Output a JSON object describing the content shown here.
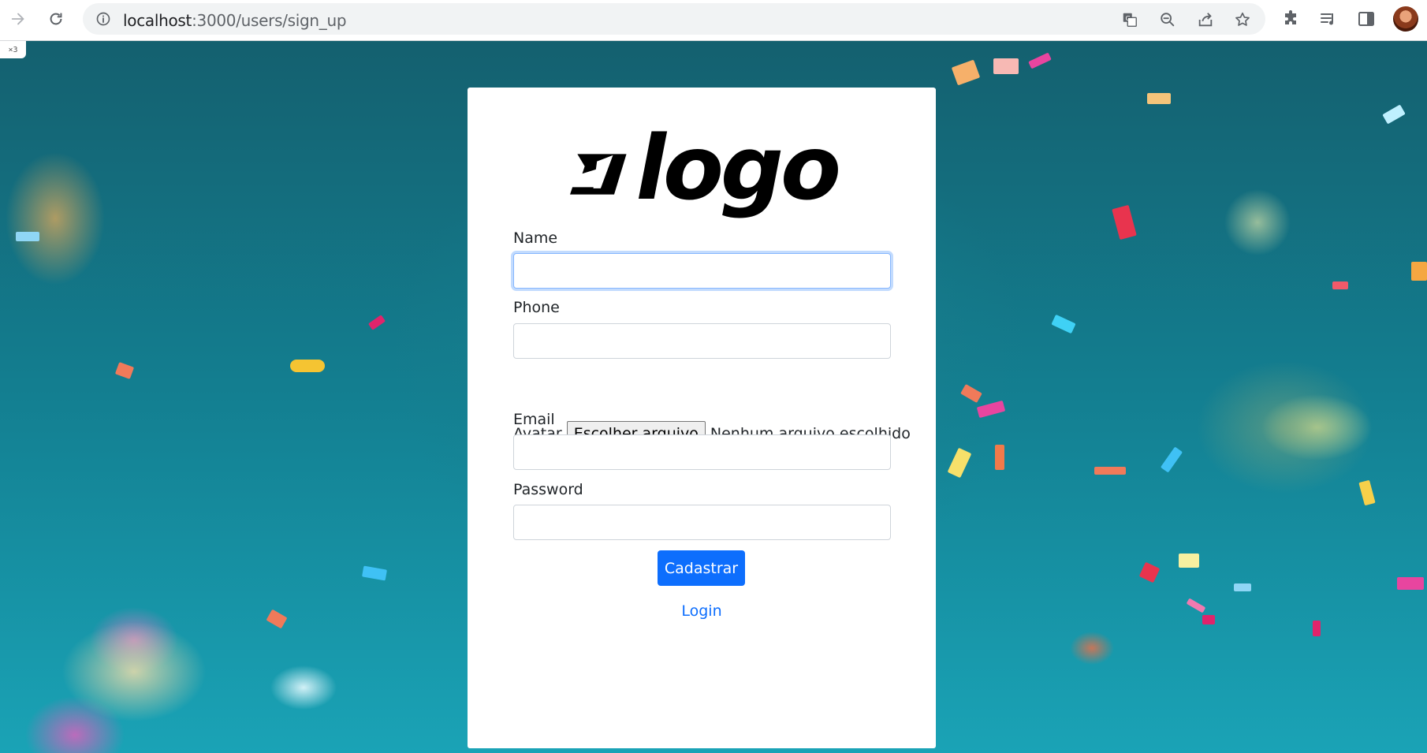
{
  "browser": {
    "url_host": "localhost",
    "url_rest": ":3000/users/sign_up",
    "tab_tag": "×3"
  },
  "form": {
    "name_label": "Name",
    "name_value": "",
    "phone_label": "Phone",
    "phone_value": "",
    "avatar_label": "Avatar",
    "file_button_label": "Escolher arquivo",
    "file_status": "Nenhum arquivo escolhido",
    "email_label": "Email",
    "email_value": "",
    "password_label": "Password",
    "password_value": "",
    "submit_label": "Cadastrar",
    "login_link": "Login"
  },
  "logo": {
    "text": "logo"
  },
  "colors": {
    "primary": "#0d6efd",
    "background_teal": "#137f91",
    "focus_border": "#86b7fe"
  }
}
